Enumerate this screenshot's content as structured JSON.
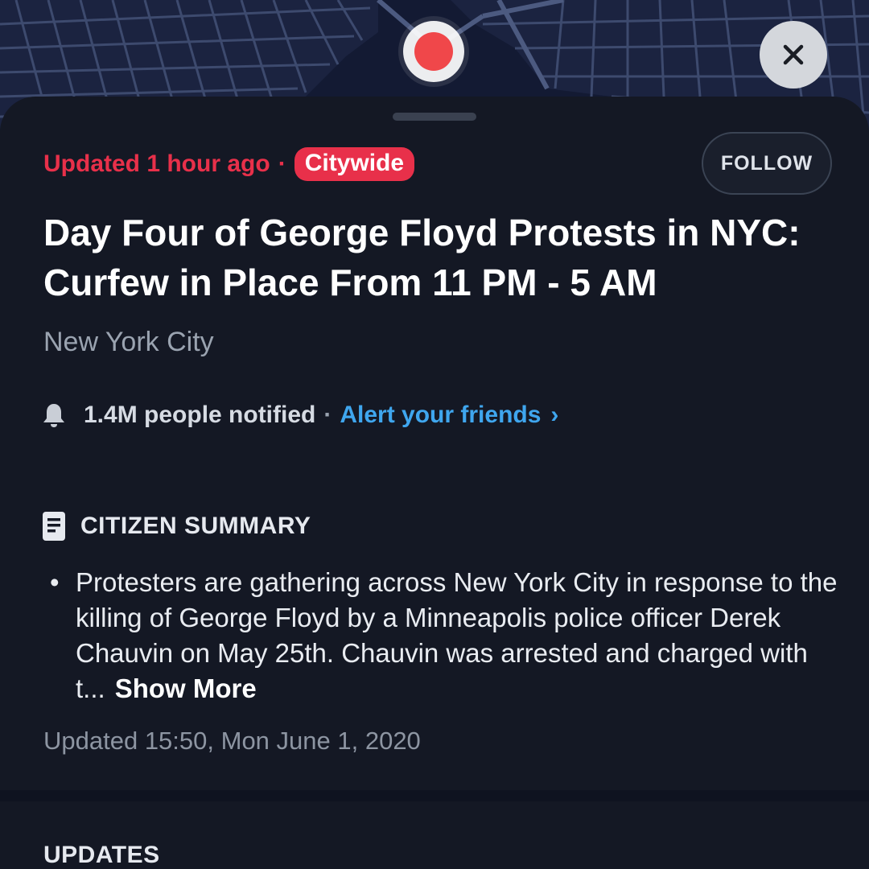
{
  "map": {
    "marker_icon": "incident-marker-icon",
    "close_icon": "close-icon"
  },
  "incident": {
    "updated_label": "Updated 1 hour ago",
    "separator": "·",
    "badge": "Citywide",
    "follow_label": "FOLLOW",
    "title": "Day Four of George Floyd Protests in NYC: Curfew in Place From 11 PM - 5 AM",
    "location": "New York City"
  },
  "notify": {
    "icon": "bell-icon",
    "count_label": "1.4M people notified",
    "separator": "·",
    "link_label": "Alert your friends",
    "chevron": "›"
  },
  "summary": {
    "icon": "document-icon",
    "heading": "CITIZEN SUMMARY",
    "bullet": "•",
    "text": "Protesters are gathering across New York City in response to the killing of George Floyd by a Minneapolis police officer Derek Chauvin on May 25th. Chauvin was arrested and charged with t...",
    "show_more_label": "Show More",
    "updated_timestamp": "Updated 15:50, Mon June 1, 2020"
  },
  "updates": {
    "heading": "UPDATES"
  },
  "colors": {
    "alert_red": "#e8304a",
    "link_blue": "#3fa6ee",
    "sheet_bg": "#141824",
    "map_bg": "#131a33",
    "marker_red": "#f0474a"
  }
}
